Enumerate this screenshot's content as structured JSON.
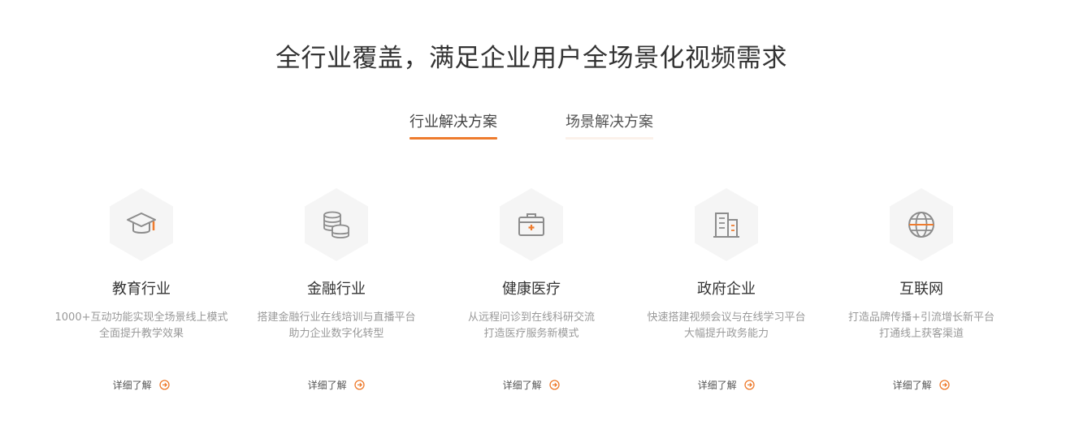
{
  "title": "全行业覆盖，满足企业用户全场景化视频需求",
  "tabs": [
    {
      "label": "行业解决方案",
      "active": true
    },
    {
      "label": "场景解决方案",
      "active": false
    }
  ],
  "cards": [
    {
      "icon": "graduation-cap-icon",
      "title": "教育行业",
      "desc_line1": "1000+互动功能实现全场景线上模式",
      "desc_line2": "全面提升教学效果",
      "more": "详细了解"
    },
    {
      "icon": "coins-icon",
      "title": "金融行业",
      "desc_line1": "搭建金融行业在线培训与直播平台",
      "desc_line2": "助力企业数字化转型",
      "more": "详细了解"
    },
    {
      "icon": "medical-kit-icon",
      "title": "健康医疗",
      "desc_line1": "从远程问诊到在线科研交流",
      "desc_line2": "打造医疗服务新模式",
      "more": "详细了解"
    },
    {
      "icon": "building-icon",
      "title": "政府企业",
      "desc_line1": "快速搭建视频会议与在线学习平台",
      "desc_line2": "大幅提升政务能力",
      "more": "详细了解"
    },
    {
      "icon": "globe-icon",
      "title": "互联网",
      "desc_line1": "打造品牌传播+引流增长新平台",
      "desc_line2": "打通线上获客渠道",
      "more": "详细了解"
    }
  ],
  "colors": {
    "accent": "#ee7b2d",
    "icon_gray": "#8c8c8c",
    "hex_bg": "#f5f5f5"
  }
}
